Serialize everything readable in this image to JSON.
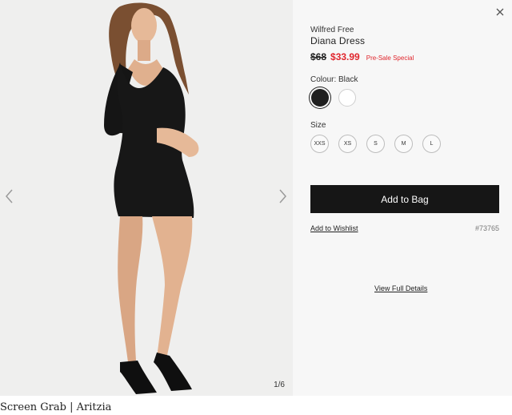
{
  "product": {
    "brand": "Wilfred Free",
    "name": "Diana Dress",
    "original_price": "$68",
    "sale_price": "$33.99",
    "sale_label": "Pre-Sale Special",
    "sku": "#73765",
    "colour_label": "Colour: Black",
    "colours": [
      {
        "name": "Black",
        "hex": "#1f1f1f",
        "selected": true
      },
      {
        "name": "White",
        "hex": "#ffffff",
        "selected": false
      }
    ],
    "size_label": "Size",
    "sizes": [
      "XXS",
      "XS",
      "S",
      "M",
      "L"
    ]
  },
  "actions": {
    "add_to_bag": "Add to Bag",
    "add_to_wishlist": "Add to Wishlist",
    "view_full_details": "View Full Details"
  },
  "gallery": {
    "counter": "1/6",
    "icons": {
      "prev": "chevron-left-icon",
      "next": "chevron-right-icon",
      "close": "close-icon"
    }
  },
  "caption": "Screen Grab | Aritzia",
  "colors": {
    "sale": "#e0262d",
    "button": "#161616",
    "panel": "#f7f7f7"
  }
}
